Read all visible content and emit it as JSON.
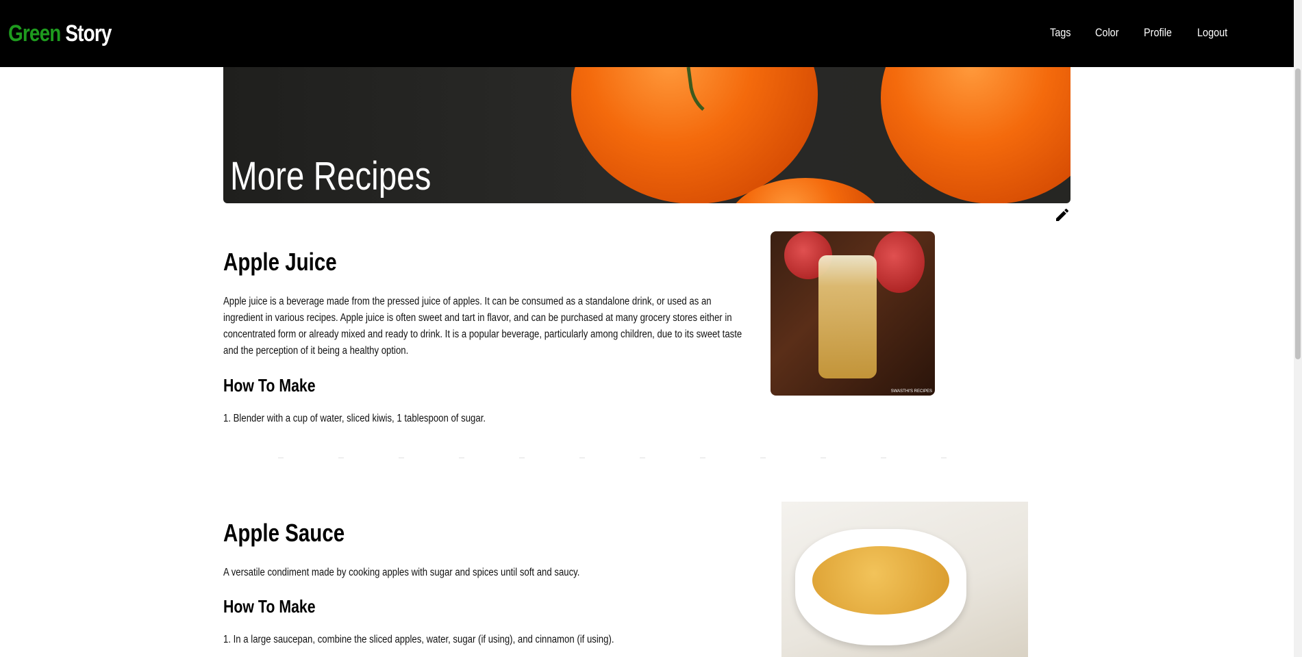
{
  "brand": {
    "part1": "Green",
    "part2": "Story"
  },
  "nav": {
    "items": [
      {
        "label": "Tags"
      },
      {
        "label": "Color"
      },
      {
        "label": "Profile"
      },
      {
        "label": "Logout"
      }
    ]
  },
  "hero": {
    "title": "More Recipes"
  },
  "recipes": [
    {
      "title": "Apple Juice",
      "description": "Apple juice is a beverage made from the pressed juice of apples. It can be consumed as a standalone drink, or used as an ingredient in various recipes. Apple juice is often sweet and tart in flavor, and can be purchased at many grocery stores either in concentrated form or already mixed and ready to drink. It is a popular beverage, particularly among children, due to its sweet taste and the perception of it being a healthy option.",
      "how_to_label": "How To Make",
      "steps": [
        "1. Blender with a cup of water, sliced kiwis, 1 tablespoon of sugar."
      ],
      "image_watermark": "SWASTHI'S RECIPES"
    },
    {
      "title": "Apple Sauce",
      "description": "A versatile condiment made by cooking apples with sugar and spices until soft and saucy.",
      "how_to_label": "How To Make",
      "steps": [
        "1. In a large saucepan, combine the sliced apples, water, sugar (if using), and cinnamon (if using)."
      ]
    }
  ],
  "icons": {
    "edit": "pencil-icon"
  },
  "colors": {
    "brand_green": "#1e9b1e",
    "navbar": "#000000"
  }
}
